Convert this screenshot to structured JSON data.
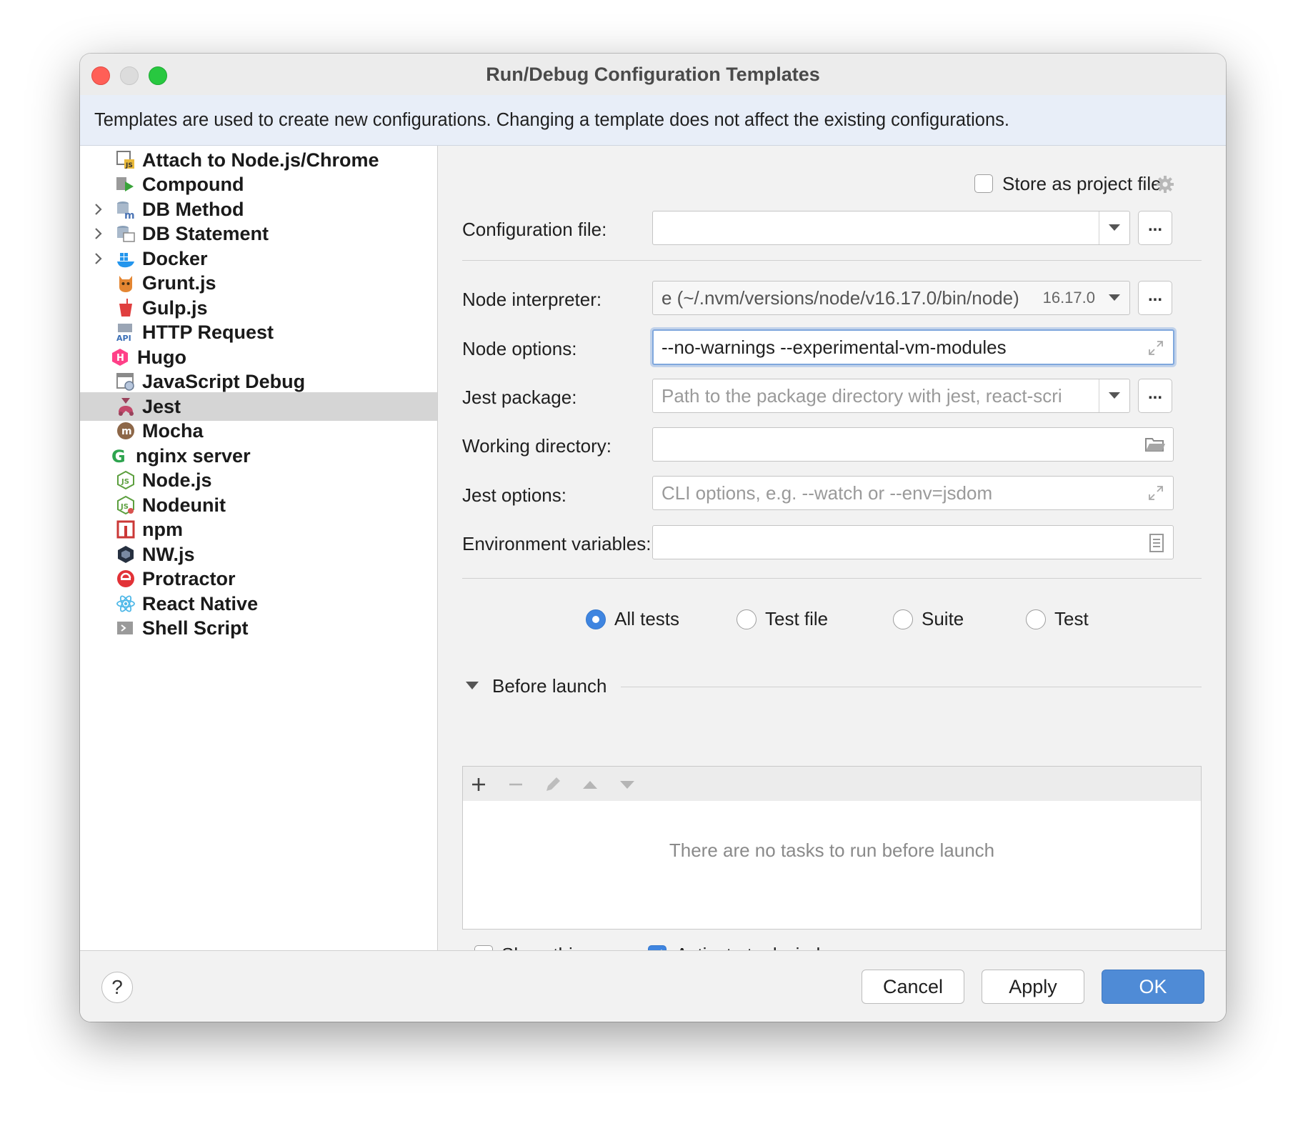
{
  "window": {
    "title": "Run/Debug Configuration Templates"
  },
  "info": "Templates are used to create new configurations. Changing a template does not affect the existing configurations.",
  "tree": [
    {
      "label": "Attach to Node.js/Chrome",
      "icon": "attach-nodejs-icon",
      "expandable": false
    },
    {
      "label": "Compound",
      "icon": "compound-icon",
      "expandable": false
    },
    {
      "label": "DB Method",
      "icon": "db-method-icon",
      "expandable": true
    },
    {
      "label": "DB Statement",
      "icon": "db-statement-icon",
      "expandable": true
    },
    {
      "label": "Docker",
      "icon": "docker-icon",
      "expandable": true
    },
    {
      "label": "Grunt.js",
      "icon": "grunt-icon",
      "expandable": false
    },
    {
      "label": "Gulp.js",
      "icon": "gulp-icon",
      "expandable": false
    },
    {
      "label": "HTTP Request",
      "icon": "http-request-icon",
      "expandable": false
    },
    {
      "label": "Hugo",
      "icon": "hugo-icon",
      "expandable": false
    },
    {
      "label": "JavaScript Debug",
      "icon": "javascript-debug-icon",
      "expandable": false
    },
    {
      "label": "Jest",
      "icon": "jest-icon",
      "expandable": false,
      "selected": true
    },
    {
      "label": "Mocha",
      "icon": "mocha-icon",
      "expandable": false
    },
    {
      "label": "nginx server",
      "icon": "nginx-icon",
      "expandable": false
    },
    {
      "label": "Node.js",
      "icon": "nodejs-icon",
      "expandable": false
    },
    {
      "label": "Nodeunit",
      "icon": "nodeunit-icon",
      "expandable": false
    },
    {
      "label": "npm",
      "icon": "npm-icon",
      "expandable": false
    },
    {
      "label": "NW.js",
      "icon": "nwjs-icon",
      "expandable": false
    },
    {
      "label": "Protractor",
      "icon": "protractor-icon",
      "expandable": false
    },
    {
      "label": "React Native",
      "icon": "react-native-icon",
      "expandable": false
    },
    {
      "label": "Shell Script",
      "icon": "shell-script-icon",
      "expandable": false
    }
  ],
  "store_as_project_file": {
    "label": "Store as project file",
    "checked": false
  },
  "form": {
    "config_file": {
      "label": "Configuration file:",
      "value": ""
    },
    "node_interpreter": {
      "label": "Node interpreter:",
      "value": "e (~/.nvm/versions/node/v16.17.0/bin/node)",
      "version": "16.17.0"
    },
    "node_options": {
      "label": "Node options:",
      "value": "--no-warnings --experimental-vm-modules"
    },
    "jest_package": {
      "label": "Jest package:",
      "value": "",
      "placeholder": "Path to the package directory with jest, react-scri"
    },
    "working_dir": {
      "label": "Working directory:",
      "value": ""
    },
    "jest_options": {
      "label": "Jest options:",
      "value": "",
      "placeholder": "CLI options, e.g. --watch or --env=jsdom"
    },
    "env_vars": {
      "label": "Environment variables:",
      "value": ""
    }
  },
  "dots_label": "...",
  "test_scope": {
    "options": [
      "All tests",
      "Test file",
      "Suite",
      "Test"
    ],
    "selected": "All tests"
  },
  "before_launch": {
    "title": "Before launch",
    "empty_text": "There are no tasks to run before launch",
    "toolbar": [
      "add-icon",
      "remove-icon",
      "edit-icon",
      "move-up-icon",
      "move-down-icon"
    ]
  },
  "show_this_page": {
    "label": "Show this page",
    "checked": false
  },
  "activate_tool_window": {
    "label": "Activate tool window",
    "checked": true
  },
  "buttons": {
    "help": "?",
    "cancel": "Cancel",
    "apply": "Apply",
    "ok": "OK"
  },
  "colors": {
    "accent": "#4f8bd6",
    "selection": "#d5d5d5",
    "info_bg": "#e8eef8"
  }
}
